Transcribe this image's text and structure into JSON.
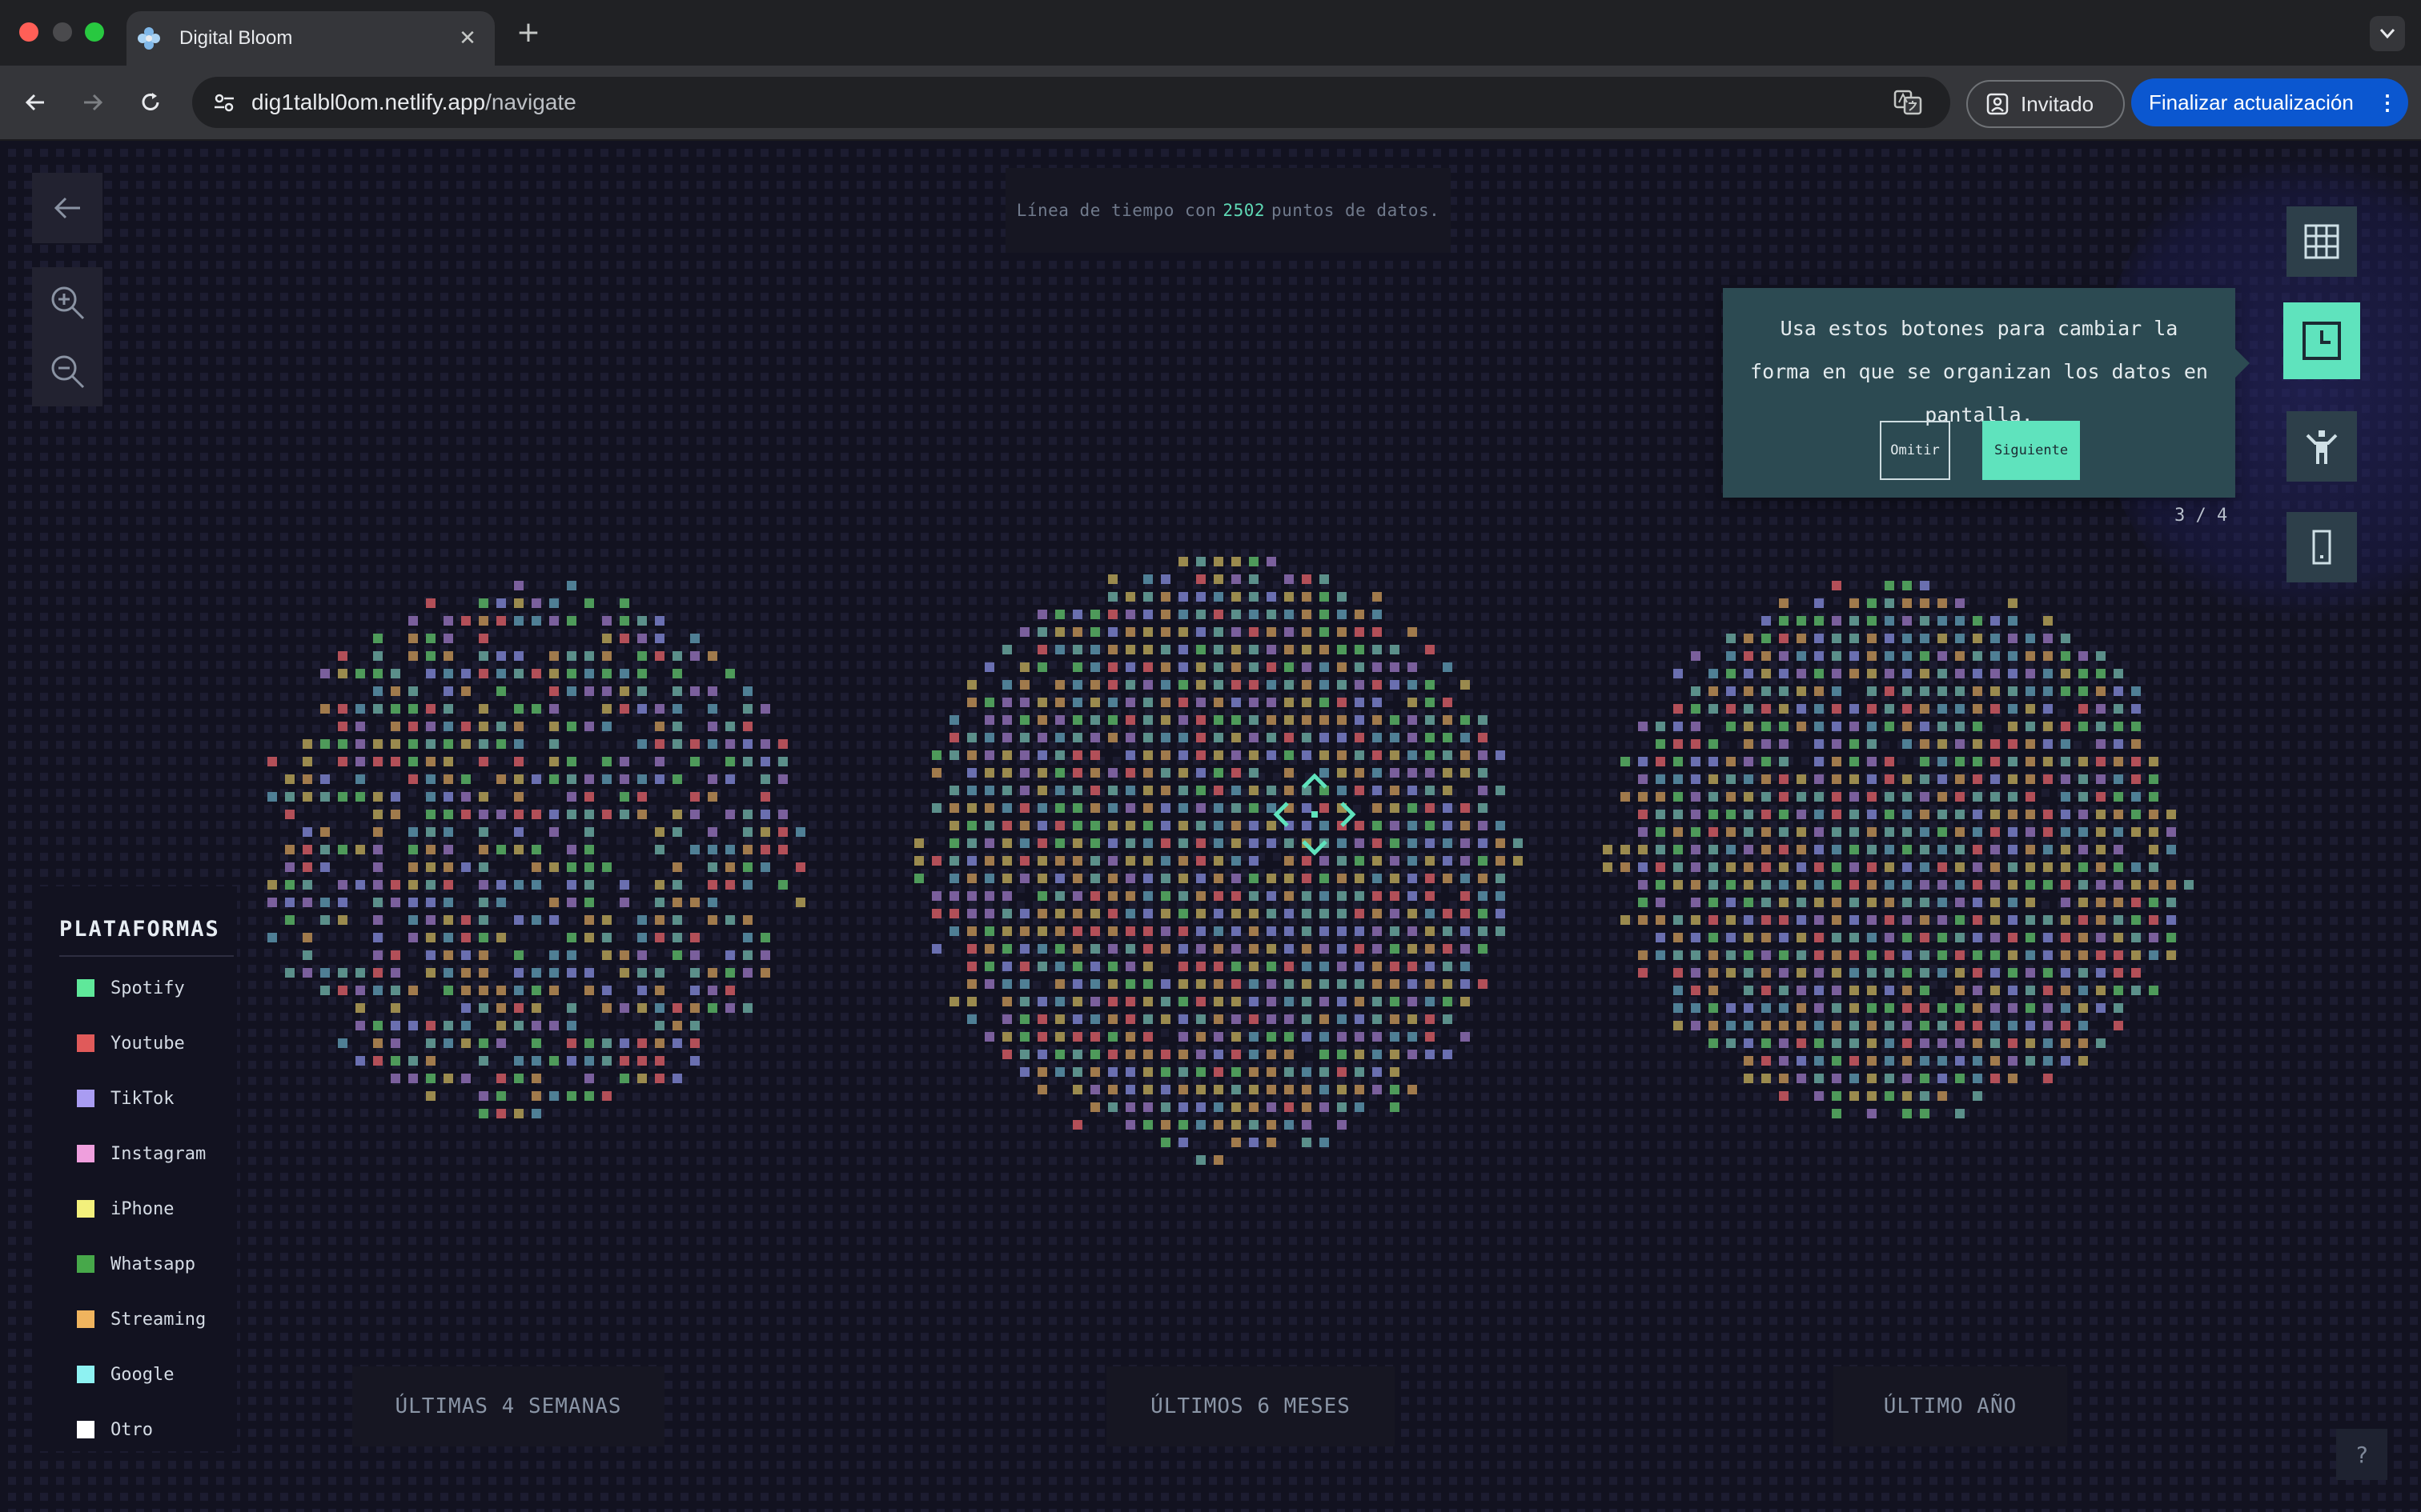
{
  "browser": {
    "tab_title": "Digital Bloom",
    "url_host": "dig1talbl0om.netlify.app",
    "url_path": "/navigate",
    "profile_label": "Invitado",
    "update_label": "Finalizar actualización"
  },
  "page": {
    "info_prefix": "Línea de tiempo con",
    "info_count": "2502",
    "info_suffix": "puntos de datos.",
    "tooltip": {
      "text": "Usa estos botones para cambiar la forma en que se organizan los datos en pantalla.",
      "skip_label": "Omitir",
      "next_label": "Siguiente",
      "step": "3 / 4"
    },
    "view_buttons": [
      {
        "icon": "grid-icon",
        "active": false
      },
      {
        "icon": "clock-icon",
        "active": true
      },
      {
        "icon": "person-icon",
        "active": false
      },
      {
        "icon": "phone-icon",
        "active": false
      }
    ],
    "legend": {
      "title": "PLATAFORMAS",
      "items": [
        {
          "label": "Spotify",
          "color": "#5fe89a"
        },
        {
          "label": "Youtube",
          "color": "#e05a5a"
        },
        {
          "label": "TikTok",
          "color": "#a99cf2"
        },
        {
          "label": "Instagram",
          "color": "#ef9fdd"
        },
        {
          "label": "iPhone",
          "color": "#f3f07c"
        },
        {
          "label": "Whatsapp",
          "color": "#47a84a"
        },
        {
          "label": "Streaming",
          "color": "#f0b45e"
        },
        {
          "label": "Google",
          "color": "#8ef2f2"
        },
        {
          "label": "Otro",
          "color": "#ffffff"
        }
      ]
    },
    "periods": [
      "ÚLTIMAS 4 SEMANAS",
      "ÚLTIMOS 6 MESES",
      "ÚLTIMO AÑO"
    ],
    "help_label": "?"
  },
  "dot_palette": [
    "#5b8f8a",
    "#7a5f9c",
    "#b24f58",
    "#4e9a5a",
    "#9a8a4e",
    "#6a6fb0",
    "#a07a4c",
    "#4f7f95"
  ]
}
